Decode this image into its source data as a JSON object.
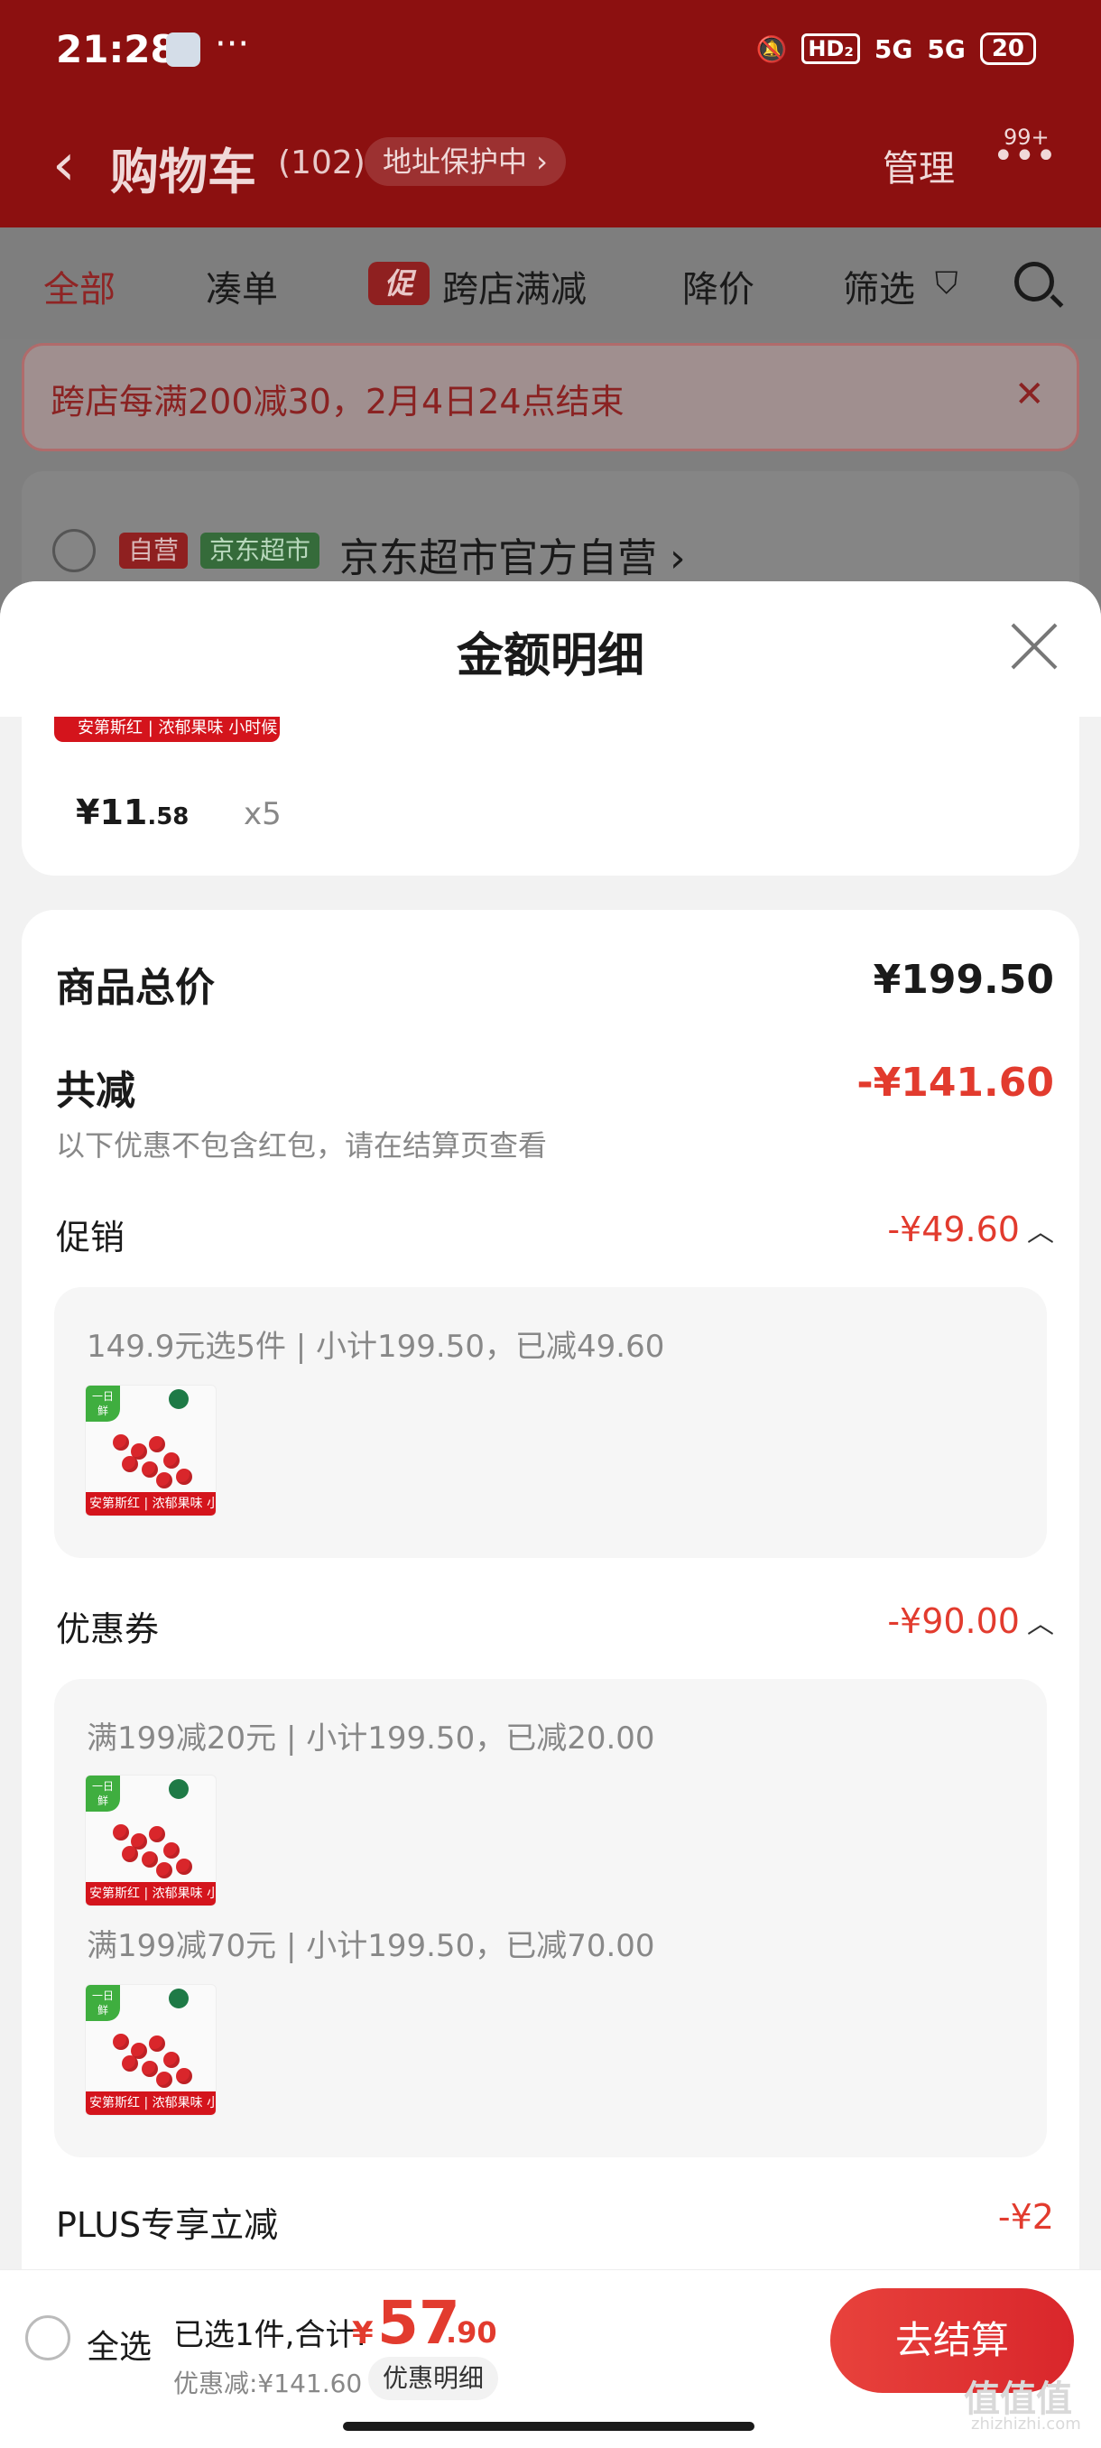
{
  "status_bar": {
    "time": "21:28",
    "dots": "···",
    "hd": "HD₂",
    "net1": "5G",
    "net2": "5G",
    "battery": "20"
  },
  "header": {
    "back": "‹",
    "title": "购物车",
    "count": "(102)",
    "address": "地址保护中 ›",
    "manage": "管理",
    "more": "•••",
    "badge": "99+"
  },
  "tabs": {
    "all": "全部",
    "combine": "凑单",
    "promo_tag": "促",
    "cross_store": "跨店满减",
    "price_drop": "降价",
    "filter": "筛选"
  },
  "banner": {
    "text": "跨店每满200减30，2月4日24点结束",
    "close": "✕"
  },
  "shop": {
    "self_tag": "自营",
    "market_tag": "京东超市",
    "name": "京东超市官方自营 ›"
  },
  "sheet": {
    "title": "金额明细",
    "item": {
      "strip": "安第斯红 | 浓郁果味 小时候的味道",
      "price_int": "¥11",
      "price_dec": ".58",
      "qty": "x5"
    },
    "total_label": "商品总价",
    "total_value": "¥199.50",
    "reduce_label": "共减",
    "reduce_value": "-¥141.60",
    "hint": "以下优惠不包含红包，请在结算页查看",
    "promo_label": "促销",
    "promo_value": "-¥49.60",
    "promo_detail": "149.9元选5件 | 小计199.50，已减49.60",
    "coupon_label": "优惠券",
    "coupon_value": "-¥90.00",
    "coupon_detail_1": "满199减20元 | 小计199.50，已减20.00",
    "coupon_detail_2": "满199减70元 | 小计199.50，已减70.00",
    "plus_label": "PLUS专享立减",
    "plus_value": "-¥2",
    "chevron": "︿",
    "product_tag": "一日鲜",
    "product_bar": "安第斯红 | 浓郁果味 小时候的味道"
  },
  "bottom": {
    "select_all": "全选",
    "selected": "已选1件,合计:",
    "currency": "¥",
    "int": "57",
    "dec": ".90",
    "discount": "优惠减:¥141.60",
    "detail_btn": "优惠明细",
    "checkout": "去结算",
    "watermark": "值值值",
    "watermark_sub": "zhizhizhi.com"
  },
  "colors": {
    "accent_red": "#e23b2e",
    "header_bg": "#8c1010",
    "market_green": "#356b3a"
  }
}
